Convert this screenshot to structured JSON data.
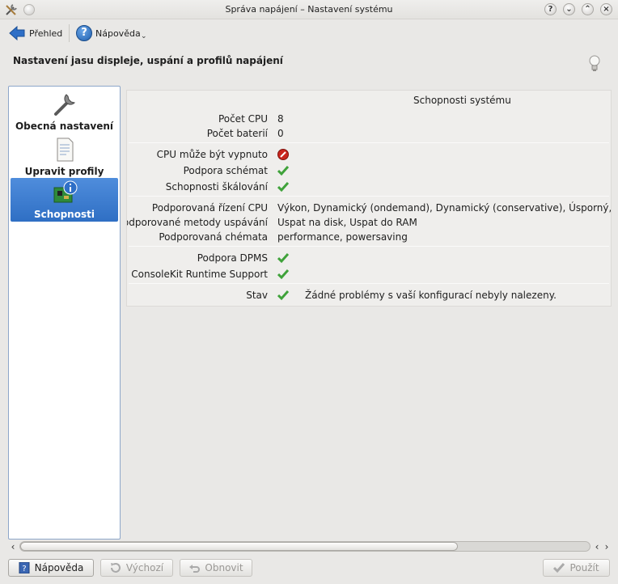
{
  "window": {
    "title": "Správa napájení – Nastavení systému"
  },
  "toolbar": {
    "back_label": "Přehled",
    "help_label": "Nápověda"
  },
  "header": {
    "title": "Nastavení jasu displeje, uspání a profilů napájení"
  },
  "sidebar": {
    "items": [
      {
        "label": "Obecná nastavení",
        "icon": "wrench-icon",
        "active": false
      },
      {
        "label": "Upravit profily",
        "icon": "document-icon",
        "active": false
      },
      {
        "label": "Schopnosti",
        "icon": "hardware-info-icon",
        "active": true
      }
    ]
  },
  "capabilities": {
    "section_title": "Schopnosti systému",
    "cpu_count_label": "Počet CPU",
    "cpu_count_value": "8",
    "battery_count_label": "Počet baterií",
    "battery_count_value": "0",
    "cpu_offline_label": "CPU může být vypnuto",
    "scheme_support_label": "Podpora schémat",
    "scaling_label": "Schopnosti škálování",
    "cpu_governors_label": "Podporovaná řízení CPU",
    "cpu_governors_value": "Výkon, Dynamický (ondemand), Dynamický (conservative), Úsporný, Userspa",
    "sleep_methods_label": "Podporované metody uspávání",
    "sleep_methods_value": "Uspat na disk, Uspat do RAM",
    "schemes_label": "Podporovaná chémata",
    "schemes_value": "performance, powersaving",
    "dpms_label": "Podpora DPMS",
    "consolekit_label": "ConsoleKit Runtime Support",
    "status_label": "Stav",
    "status_value": "Žádné problémy s vaší konfigurací nebyly nalezeny."
  },
  "scrollbar": {
    "thumb_fraction": 0.77
  },
  "buttons": {
    "help": "Nápověda",
    "defaults": "Výchozí",
    "reset": "Obnovit",
    "apply": "Použít"
  },
  "colors": {
    "accent": "#2f6fc4",
    "check": "#3fa23a",
    "stop": "#c9261e"
  }
}
